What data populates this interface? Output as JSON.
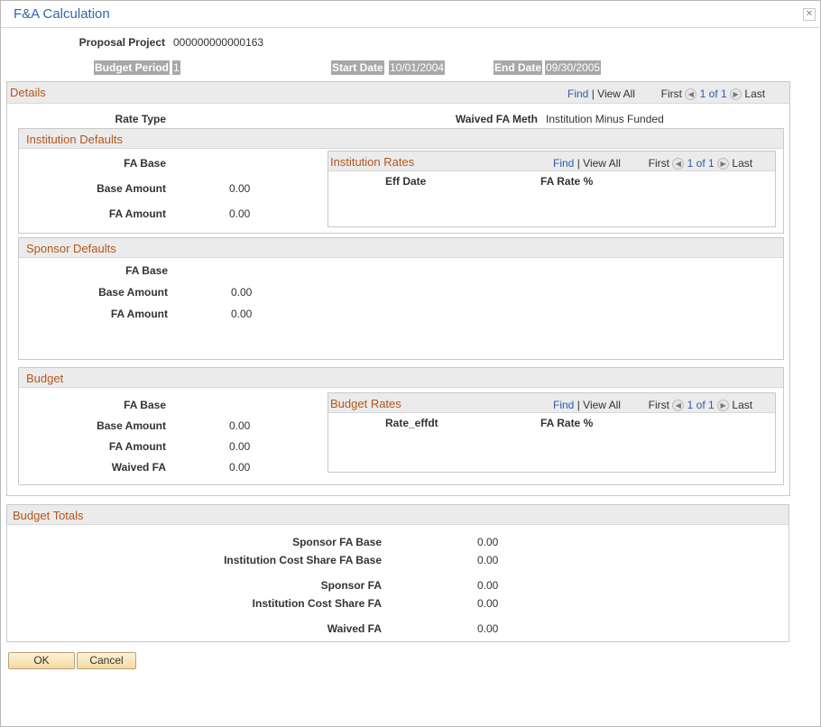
{
  "window": {
    "title": "F&A Calculation",
    "close_glyph": "✕"
  },
  "header": {
    "proposal_project_label": "Proposal Project",
    "proposal_project_value": "000000000000163",
    "budget_period_label": "Budget Period",
    "budget_period_value": "1",
    "start_date_label": "Start Date",
    "start_date_value": "10/01/2004",
    "end_date_label": "End Date",
    "end_date_value": "09/30/2005"
  },
  "details": {
    "title": "Details",
    "nav": {
      "find": "Find",
      "view_all": "View All",
      "first": "First",
      "counter": "1 of 1",
      "last": "Last"
    },
    "rate_type_label": "Rate Type",
    "waived_fa_meth_label": "Waived FA Meth",
    "waived_fa_meth_value": "Institution Minus Funded",
    "institution_defaults": {
      "title": "Institution Defaults",
      "fa_base_label": "FA Base",
      "base_amount_label": "Base Amount",
      "base_amount_value": "0.00",
      "fa_amount_label": "FA Amount",
      "fa_amount_value": "0.00",
      "rates": {
        "title": "Institution Rates",
        "nav": {
          "find": "Find",
          "view_all": "View All",
          "first": "First",
          "counter": "1 of 1",
          "last": "Last"
        },
        "col_date": "Eff Date",
        "col_rate": "FA Rate %"
      }
    },
    "sponsor_defaults": {
      "title": "Sponsor Defaults",
      "fa_base_label": "FA Base",
      "base_amount_label": "Base Amount",
      "base_amount_value": "0.00",
      "fa_amount_label": "FA Amount",
      "fa_amount_value": "0.00"
    },
    "budget": {
      "title": "Budget",
      "fa_base_label": "FA Base",
      "base_amount_label": "Base Amount",
      "base_amount_value": "0.00",
      "fa_amount_label": "FA Amount",
      "fa_amount_value": "0.00",
      "waived_fa_label": "Waived FA",
      "waived_fa_value": "0.00",
      "rates": {
        "title": "Budget Rates",
        "nav": {
          "find": "Find",
          "view_all": "View All",
          "first": "First",
          "counter": "1 of 1",
          "last": "Last"
        },
        "col_date": "Rate_effdt",
        "col_rate": "FA Rate %"
      }
    }
  },
  "totals": {
    "title": "Budget Totals",
    "sponsor_fa_base_label": "Sponsor FA Base",
    "sponsor_fa_base_value": "0.00",
    "inst_cost_share_fa_base_label": "Institution Cost Share FA Base",
    "inst_cost_share_fa_base_value": "0.00",
    "sponsor_fa_label": "Sponsor FA",
    "sponsor_fa_value": "0.00",
    "inst_cost_share_fa_label": "Institution Cost Share FA",
    "inst_cost_share_fa_value": "0.00",
    "waived_fa_label": "Waived FA",
    "waived_fa_value": "0.00"
  },
  "buttons": {
    "ok": "OK",
    "cancel": "Cancel"
  },
  "icons": {
    "prev": "◀",
    "next": "▶"
  }
}
